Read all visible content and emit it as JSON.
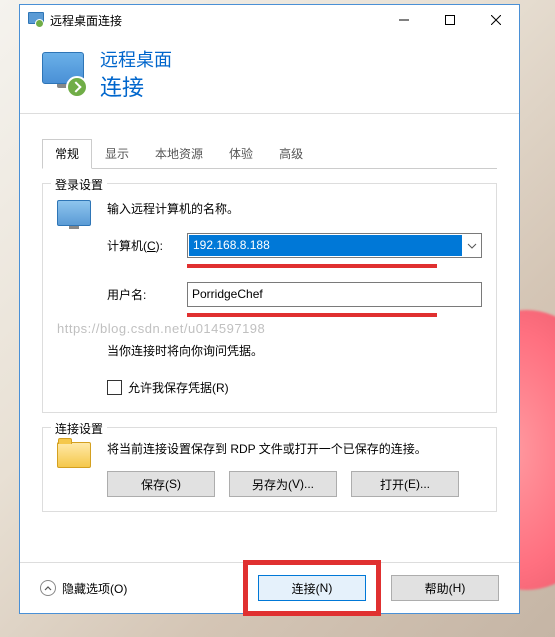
{
  "window": {
    "title": "远程桌面连接"
  },
  "header": {
    "line1": "远程桌面",
    "line2": "连接"
  },
  "tabs": {
    "items": [
      {
        "label": "常规"
      },
      {
        "label": "显示"
      },
      {
        "label": "本地资源"
      },
      {
        "label": "体验"
      },
      {
        "label": "高级"
      }
    ],
    "active_index": 0
  },
  "login": {
    "group_title": "登录设置",
    "prompt": "输入远程计算机的名称。",
    "computer_label_pre": "计算机(",
    "computer_label_u": "C",
    "computer_label_post": "):",
    "computer_value": "192.168.8.188",
    "user_label": "用户名:",
    "user_value": "PorridgeChef",
    "note": "当你连接时将向你询问凭据。",
    "checkbox_pre": "允许我保存凭据(",
    "checkbox_u": "R",
    "checkbox_post": ")"
  },
  "watermark": "https://blog.csdn.net/u014597198",
  "conn": {
    "group_title": "连接设置",
    "desc": "将当前连接设置保存到 RDP 文件或打开一个已保存的连接。",
    "save_pre": "保存(",
    "save_u": "S",
    "save_post": ")",
    "saveas_pre": "另存为(",
    "saveas_u": "V",
    "saveas_post": ")...",
    "open_pre": "打开(",
    "open_u": "E",
    "open_post": ")..."
  },
  "footer": {
    "hide_pre": "隐藏选项(",
    "hide_u": "O",
    "hide_post": ")",
    "connect_pre": "连接(",
    "connect_u": "N",
    "connect_post": ")",
    "help_pre": "帮助(",
    "help_u": "H",
    "help_post": ")"
  }
}
